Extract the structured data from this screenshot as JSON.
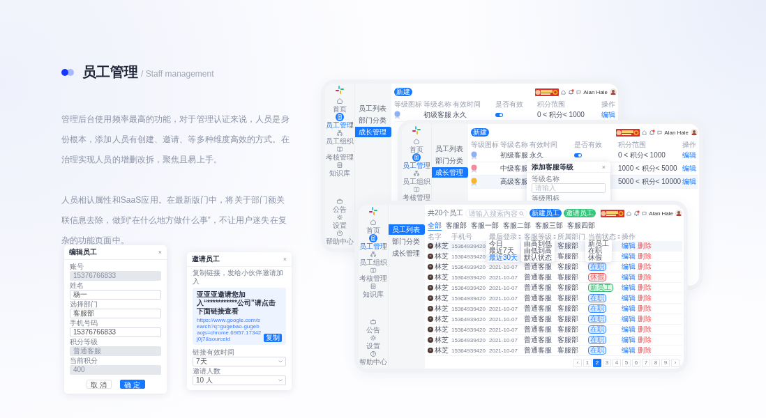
{
  "heading": {
    "title": "员工管理",
    "subtitle": "/ Staff management"
  },
  "paragraphs": [
    "管理后台使用频率最高的功能，对于管理认证来说，人员是身份根本，添加人员有创建、邀请、等多种维度高效的方式。在治理实现人员的增删改拆，聚焦且易上手。",
    "人员相认属性和SaaS应用。在最新版门中，将关于部门额关联信息去除，做到“在什么地方做什么事”，不让用户迷失在复杂的功能页面中。"
  ],
  "edit_dialog": {
    "title": "编辑员工",
    "close": "×",
    "fields": [
      {
        "label": "账号",
        "value": "15376766833",
        "disabled": true
      },
      {
        "label": "姓名",
        "value": "杨一",
        "disabled": false
      },
      {
        "label": "选择部门",
        "value": "客服部",
        "disabled": false
      },
      {
        "label": "手机号码",
        "value": "15376766833",
        "disabled": false
      },
      {
        "label": "积分等级",
        "value": "普通客服",
        "disabled": true
      },
      {
        "label": "当前积分",
        "value": "400",
        "disabled": true
      }
    ],
    "buttons": [
      {
        "label": "取 消",
        "primary": false
      },
      {
        "label": "确 定",
        "primary": true
      }
    ]
  },
  "invite_dialog": {
    "title": "邀请员工",
    "close": "×",
    "hint": "复制链接，发给小伙伴邀请加入",
    "message": "亚亚亚邀请您加入“***********公司”请点击下面链接查看",
    "link": "https://www.google.com/search?q=gugebao-gugebaojs=chrome.69i57.17342j0j7&sourceid",
    "copy_button": "复制",
    "selects": [
      {
        "label": "链接有效时间",
        "value": "7天"
      },
      {
        "label": "邀请人数",
        "value": "10 人"
      }
    ]
  },
  "windows": [
    {
      "kind": "levels",
      "new_button": "新建",
      "user": "Alan Hale",
      "rail": [
        {
          "label": "首页",
          "selected": false
        },
        {
          "label": "员工管理",
          "selected": true
        },
        {
          "label": "员工组织",
          "selected": false
        },
        {
          "label": "考核管理",
          "selected": false
        },
        {
          "label": "知识库",
          "selected": false
        }
      ],
      "rail_bottom": [
        "公告",
        "设置",
        "帮助中心"
      ],
      "submenu": [
        {
          "label": "员工列表",
          "selected": false
        },
        {
          "label": "部门分类",
          "selected": false
        },
        {
          "label": "成长管理",
          "selected": true
        }
      ],
      "columns": [
        "等级图标",
        "等级名称",
        "有效时间",
        "是否有效",
        "积分范围",
        "操作"
      ],
      "rows": [
        {
          "color": "#8fb0f0",
          "name": "初级客服",
          "validity": "永久",
          "on": true,
          "range": "0 < 积分< 1000",
          "action": "编辑",
          "selected": false
        }
      ]
    },
    {
      "kind": "levels",
      "new_button": "新建",
      "user": "Alan Hale",
      "rail": [
        {
          "label": "首页",
          "selected": false
        },
        {
          "label": "员工管理",
          "selected": true
        },
        {
          "label": "员工组织",
          "selected": false
        },
        {
          "label": "考核管理",
          "selected": false
        }
      ],
      "submenu": [
        {
          "label": "员工列表",
          "selected": false
        },
        {
          "label": "部门分类",
          "selected": false
        },
        {
          "label": "成长管理",
          "selected": true
        }
      ],
      "columns": [
        "等级图标",
        "等级名称",
        "有效时间",
        "是否有效",
        "积分范围",
        "操作"
      ],
      "rows": [
        {
          "color": "#8fb0f0",
          "name": "初级客服",
          "validity": "永久",
          "on": true,
          "range": "0 < 积分< 1000",
          "action": "编辑",
          "selected": false
        },
        {
          "color": "#f28b9b",
          "name": "中级客服",
          "range": "1000 < 积分< 5000",
          "action": "编辑",
          "selected": false
        },
        {
          "color": "#f5b52e",
          "name": "高级客服",
          "range": "5000 < 积分< 10000",
          "action": "编辑",
          "selected": true
        }
      ],
      "modal": {
        "title": "添加客服等级",
        "close": "×",
        "name_label": "等级名称",
        "name_placeholder": "请输入",
        "icon_label": "等级图标"
      }
    },
    {
      "kind": "staff",
      "count_label": "共20个员工",
      "search_placeholder": "请输入搜索内容",
      "buttons": [
        {
          "label": "新建员工",
          "color": "#1677ff"
        },
        {
          "label": "邀请员工",
          "color": "#34c77b"
        }
      ],
      "user": "Alan Hale",
      "rail": [
        {
          "label": "首页",
          "selected": false
        },
        {
          "label": "员工管理",
          "selected": true
        },
        {
          "label": "员工组织",
          "selected": false
        },
        {
          "label": "考核管理",
          "selected": false
        },
        {
          "label": "知识库",
          "selected": false
        }
      ],
      "rail_bottom": [
        "公告",
        "设置",
        "帮助中心"
      ],
      "submenu": [
        {
          "label": "员工列表",
          "selected": true
        },
        {
          "label": "部门分类",
          "selected": false
        },
        {
          "label": "成长管理",
          "selected": false
        }
      ],
      "tabs": [
        {
          "label": "全部",
          "selected": true
        },
        {
          "label": "客服部",
          "selected": false
        },
        {
          "label": "客服一部",
          "selected": false
        },
        {
          "label": "客服二部",
          "selected": false
        },
        {
          "label": "客服三部",
          "selected": false
        },
        {
          "label": "客服四部",
          "selected": false
        }
      ],
      "columns": [
        {
          "label": "名字",
          "sortable": false
        },
        {
          "label": "手机号",
          "sortable": false
        },
        {
          "label": "最后登录",
          "sortable": true,
          "menu": [
            {
              "label": "今日",
              "selected": false
            },
            {
              "label": "最近7天",
              "selected": false
            },
            {
              "label": "最近30天",
              "selected": true
            }
          ]
        },
        {
          "label": "客服等级",
          "sortable": true,
          "menu": [
            {
              "label": "由高到低",
              "selected": false
            },
            {
              "label": "由低到高",
              "selected": false
            },
            {
              "label": "默认状态",
              "selected": false
            }
          ]
        },
        {
          "label": "所属部门",
          "sortable": false
        },
        {
          "label": "当前状态",
          "sortable": true,
          "menu": [
            {
              "label": "新员工",
              "selected": false
            },
            {
              "label": "在职",
              "selected": false
            },
            {
              "label": "休假",
              "selected": false
            }
          ]
        },
        {
          "label": "操作",
          "sortable": false
        }
      ],
      "rows": [
        {
          "name": "林芝",
          "phone": "15364939420",
          "dept": "客服部",
          "edit": "编辑",
          "delete": "删除",
          "selected": true
        },
        {
          "name": "林芝",
          "phone": "15364939420",
          "dept": "客服部",
          "edit": "编辑",
          "delete": "删除",
          "selected": false
        },
        {
          "name": "林芝",
          "phone": "15364939420",
          "date": "2021-10-07",
          "level": "普通客服",
          "dept": "客服部",
          "status": {
            "text": "在职",
            "color": "#3d8bff"
          },
          "edit": "编辑",
          "delete": "删除",
          "selected": false
        },
        {
          "name": "林芝",
          "phone": "15364939420",
          "date": "2021-10-07",
          "level": "普通客服",
          "dept": "客服部",
          "status": {
            "text": "休假",
            "color": "#f0565a"
          },
          "edit": "编辑",
          "delete": "删除",
          "selected": false
        },
        {
          "name": "林芝",
          "phone": "15364939420",
          "date": "2021-10-07",
          "level": "普通客服",
          "dept": "客服部",
          "status": {
            "text": "新员工",
            "color": "#2fb86a"
          },
          "edit": "编辑",
          "delete": "删除",
          "selected": false
        },
        {
          "name": "林芝",
          "phone": "15364939420",
          "date": "2021-10-07",
          "level": "普通客服",
          "dept": "客服部",
          "status": {
            "text": "在职",
            "color": "#3d8bff"
          },
          "edit": "编辑",
          "delete": "删除",
          "selected": false
        },
        {
          "name": "林芝",
          "phone": "15364939420",
          "date": "2021-10-07",
          "level": "普通客服",
          "dept": "客服部",
          "status": {
            "text": "在职",
            "color": "#3d8bff"
          },
          "edit": "编辑",
          "delete": "删除",
          "selected": false
        },
        {
          "name": "林芝",
          "phone": "15364939420",
          "date": "2021-10-07",
          "level": "普通客服",
          "dept": "客服部",
          "status": {
            "text": "在职",
            "color": "#3d8bff"
          },
          "edit": "编辑",
          "delete": "删除",
          "selected": false
        },
        {
          "name": "林芝",
          "phone": "15364939420",
          "date": "2021-10-07",
          "level": "普通客服",
          "dept": "客服部",
          "status": {
            "text": "在职",
            "color": "#3d8bff"
          },
          "edit": "编辑",
          "delete": "删除",
          "selected": false
        },
        {
          "name": "林芝",
          "phone": "15364939420",
          "date": "2021-10-07",
          "level": "普通客服",
          "dept": "客服部",
          "status": {
            "text": "在职",
            "color": "#3d8bff"
          },
          "edit": "编辑",
          "delete": "删除",
          "selected": false
        },
        {
          "name": "林芝",
          "phone": "15364939420",
          "date": "2021-10-07",
          "level": "普通客服",
          "dept": "客服部",
          "status": {
            "text": "在职",
            "color": "#3d8bff"
          },
          "edit": "编辑",
          "delete": "删除",
          "selected": false
        }
      ],
      "pagination": {
        "prev": "‹",
        "next": "›",
        "pages": [
          {
            "label": "1",
            "selected": false
          },
          {
            "label": "2",
            "selected": true
          },
          {
            "label": "3",
            "selected": false
          },
          {
            "label": "4",
            "selected": false
          },
          {
            "label": "5",
            "selected": false
          },
          {
            "label": "6",
            "selected": false
          },
          {
            "label": "7",
            "selected": false
          },
          {
            "label": "8",
            "selected": false
          },
          {
            "label": "9",
            "selected": false
          }
        ]
      }
    }
  ]
}
